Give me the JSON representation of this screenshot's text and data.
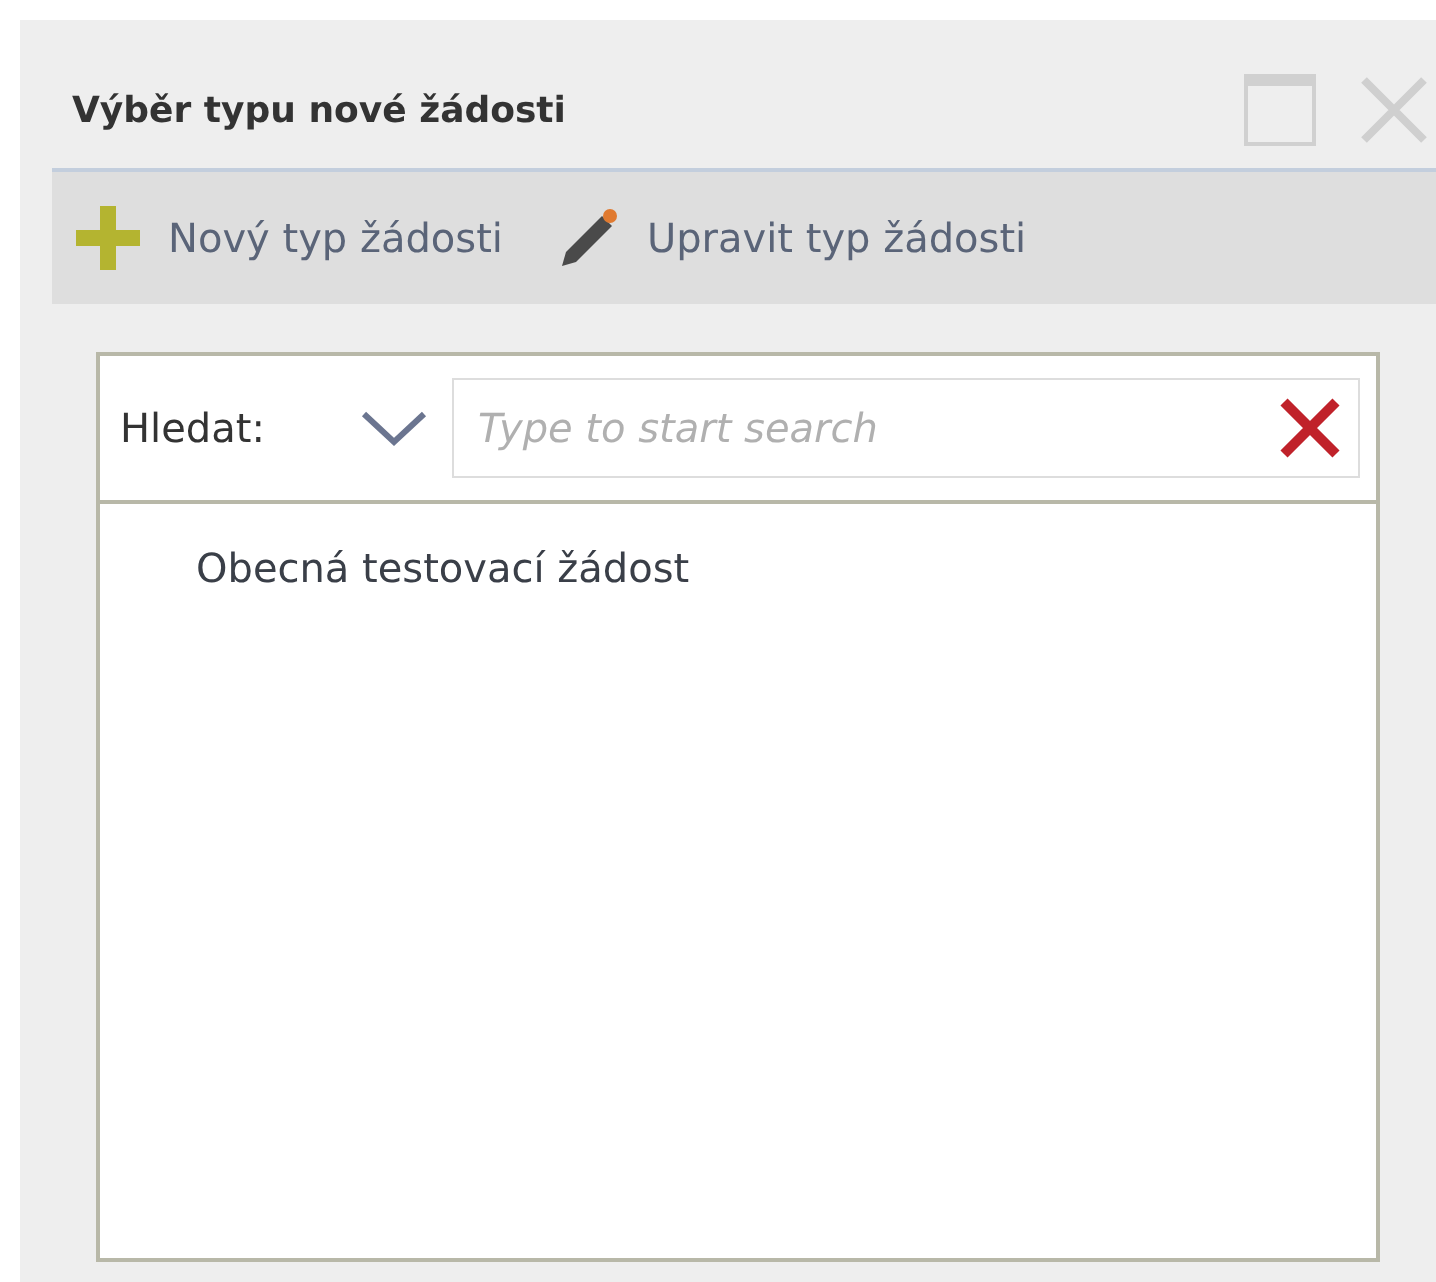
{
  "window": {
    "title": "Výběr typu nové žádosti"
  },
  "toolbar": [
    {
      "kind": "add",
      "label": "Nový typ žádosti"
    },
    {
      "kind": "edit",
      "label": "Upravit typ žádosti"
    }
  ],
  "search": {
    "label": "Hledat:",
    "placeholder": "Type to start search"
  },
  "list": [
    {
      "label": "Obecná testovací žádost",
      "selected": false
    }
  ]
}
